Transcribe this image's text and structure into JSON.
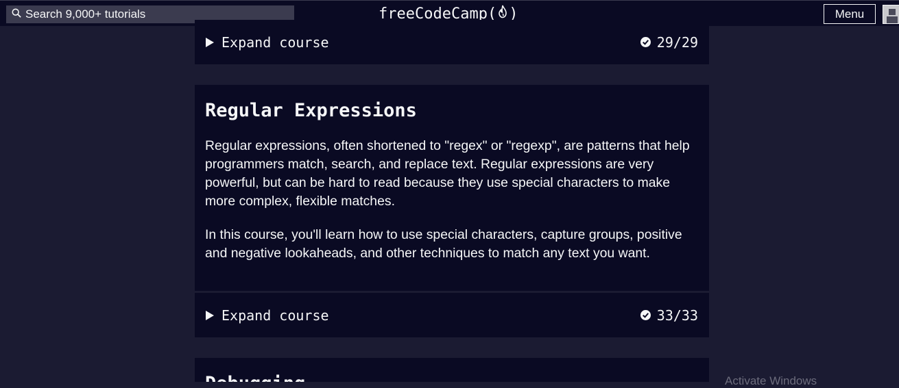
{
  "navbar": {
    "search_placeholder": "Search 9,000+ tutorials",
    "logo_text": "freeCodeCamp(",
    "logo_close": ")",
    "menu_label": "Menu"
  },
  "courses": [
    {
      "expand_label": "Expand course",
      "progress": "29/29"
    },
    {
      "title": "Regular Expressions",
      "paragraphs": [
        "Regular expressions, often shortened to \"regex\" or \"regexp\", are patterns that help programmers match, search, and replace text. Regular expressions are very powerful, but can be hard to read because they use special characters to make more complex, flexible matches.",
        "In this course, you'll learn how to use special characters, capture groups, positive and negative lookaheads, and other techniques to match any text you want."
      ],
      "expand_label": "Expand course",
      "progress": "33/33"
    },
    {
      "title": "Debugging"
    }
  ],
  "watermark": "Activate Windows",
  "colors": {
    "background": "#1b1b32",
    "card": "#0a0a23",
    "text": "#f5f6f7",
    "search_bg": "#3b3b4f"
  }
}
